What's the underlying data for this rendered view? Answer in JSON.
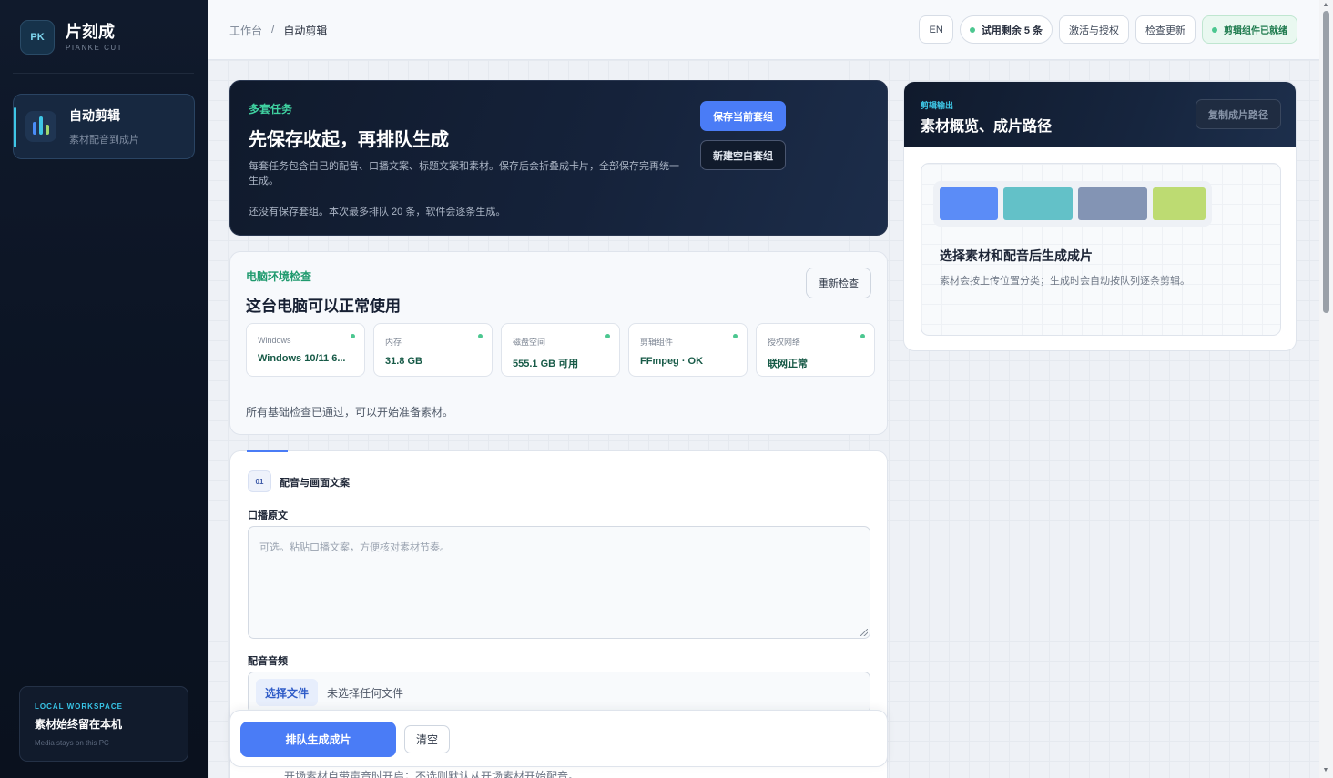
{
  "sidebar": {
    "logo_text": "PK",
    "brand_name": "片刻成",
    "brand_sub": "PIANKE CUT",
    "nav_item": {
      "title": "自动剪辑",
      "desc": "素材配音到成片",
      "icon": "bar-chart-icon"
    },
    "workspace": {
      "eyebrow": "LOCAL WORKSPACE",
      "title": "素材始终留在本机",
      "sub": "Media stays on this PC"
    }
  },
  "topbar": {
    "breadcrumb": [
      "工作台",
      "自动剪辑"
    ],
    "breadcrumb_sep": "/",
    "lang_button": "EN",
    "trial_pill": "试用剩余 5 条",
    "activate_button": "激活与授权",
    "update_button": "检查更新",
    "component_status": "剪辑组件已就绪"
  },
  "task": {
    "eyebrow": "多套任务",
    "title": "先保存收起，再排队生成",
    "desc": "每套任务包含自己的配音、口播文案、标题文案和素材。保存后会折叠成卡片，全部保存完再统一生成。",
    "note": "还没有保存套组。本次最多排队 20 条，软件会逐条生成。",
    "save_button": "保存当前套组",
    "new_button": "新建空白套组"
  },
  "env": {
    "eyebrow": "电脑环境检查",
    "title": "这台电脑可以正常使用",
    "recheck_button": "重新检查",
    "stats": [
      {
        "label": "Windows",
        "value": "Windows 10/11 6..."
      },
      {
        "label": "内存",
        "value": "31.8 GB"
      },
      {
        "label": "磁盘空间",
        "value": "555.1 GB 可用"
      },
      {
        "label": "剪辑组件",
        "value": "FFmpeg · OK"
      },
      {
        "label": "授权网络",
        "value": "联网正常"
      }
    ],
    "footer": "所有基础检查已通过，可以开始准备素材。"
  },
  "form": {
    "step_number": "01",
    "step_title": "配音与画面文案",
    "script_label": "口播原文",
    "script_placeholder": "可选。粘贴口播文案，方便核对素材节奏。",
    "audio_label": "配音音频",
    "file_button": "选择文件",
    "file_status": "未选择任何文件",
    "cutoff_text": "开场素材自带声音时开启；不选则默认从开场素材开始配音。"
  },
  "actions": {
    "queue_button": "排队生成成片",
    "clear_button": "清空"
  },
  "output": {
    "eyebrow": "剪辑输出",
    "title": "素材概览、成片路径",
    "copy_button": "复制成片路径",
    "preview_title": "选择素材和配音后生成成片",
    "preview_desc": "素材会按上传位置分类；生成时会自动按队列逐条剪辑。",
    "swatches": [
      "#5b8cf7",
      "#63c1c8",
      "#8394b4",
      "#bddb72"
    ]
  },
  "colors": {
    "accent": "#4a7cf6",
    "success": "#4cc790",
    "sidebar_bg": "#0b1322"
  }
}
